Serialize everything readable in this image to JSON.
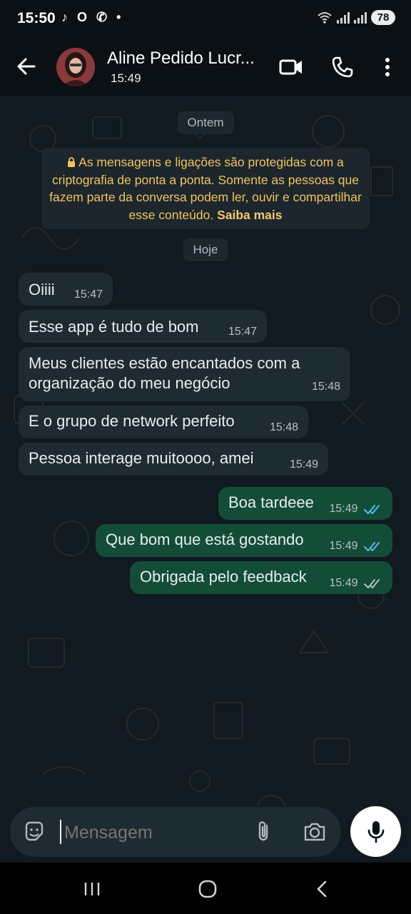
{
  "status_bar": {
    "time": "15:50",
    "apps": "♪ O ✆ •",
    "battery": "78"
  },
  "header": {
    "contact_name": "Aline Pedido Lucr...",
    "subtitle": "15:49"
  },
  "chat": {
    "date_yesterday": "Ontem",
    "encryption_notice": "As mensagens e ligações são protegidas com a criptografia de ponta a ponta. Somente as pessoas que fazem parte da conversa podem ler, ouvir e compartilhar esse conteúdo.",
    "encryption_link": "Saiba mais",
    "date_today": "Hoje",
    "messages": [
      {
        "direction": "in",
        "text": "Oiiii",
        "time": "15:47"
      },
      {
        "direction": "in",
        "text": "Esse app é tudo de bom",
        "time": "15:47"
      },
      {
        "direction": "in",
        "text": "Meus clientes estão encantados com a organização do meu negócio",
        "time": "15:48"
      },
      {
        "direction": "in",
        "text": "E o grupo de network perfeito",
        "time": "15:48"
      },
      {
        "direction": "in",
        "text": "Pessoa interage muitoooo, amei",
        "time": "15:49"
      },
      {
        "direction": "out",
        "text": "Boa tardeee",
        "time": "15:49",
        "status": "read"
      },
      {
        "direction": "out",
        "text": "Que bom que está gostando",
        "time": "15:49",
        "status": "read"
      },
      {
        "direction": "out",
        "text": "Obrigada pelo feedback",
        "time": "15:49",
        "status": "delivered"
      }
    ]
  },
  "composer": {
    "placeholder": "Mensagem"
  },
  "colors": {
    "background": "#111a20",
    "incoming_bubble": "#1f2b32",
    "outgoing_bubble": "#134d37",
    "read_tick": "#53bdeb",
    "notice_text": "#f0c461"
  }
}
